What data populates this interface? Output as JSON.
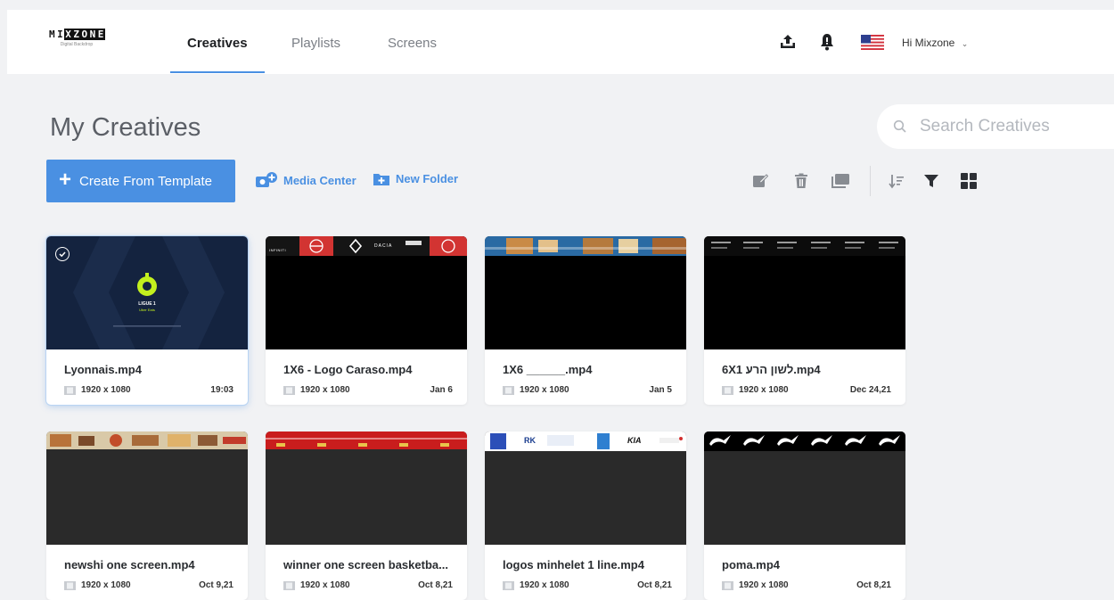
{
  "app": {
    "logo_word": [
      "M",
      "I",
      "X",
      "Z",
      "O",
      "N",
      "E"
    ],
    "logo_sub": "Digital Backdrop"
  },
  "nav": {
    "tabs": [
      {
        "label": "Creatives",
        "active": true
      },
      {
        "label": "Playlists",
        "active": false
      },
      {
        "label": "Screens",
        "active": false
      }
    ],
    "user_greeting": "Hi Mixzone",
    "icons": [
      "upload-icon",
      "bell-icon",
      "us-flag-icon",
      "chevron-down-icon"
    ]
  },
  "page": {
    "title": "My Creatives",
    "search_placeholder": "Search Creatives",
    "create_label": "Create From Template",
    "media_center_label": "Media Center",
    "new_folder_label": "New Folder",
    "toolbar_icons": [
      "edit-icon",
      "trash-icon",
      "duplicate-icon",
      "sort-icon",
      "filter-icon",
      "grid-view-icon"
    ]
  },
  "colors": {
    "accent": "#4a90e2",
    "background": "#f1f2f4",
    "card": "#ffffff"
  },
  "creatives": [
    {
      "name": "Lyonnais.mp4",
      "resolution": "1920 x 1080",
      "date": "19:03",
      "selected": true,
      "thumb": "ligue1",
      "thumb_text": [
        "LIGUE 1",
        "Uber Eats"
      ]
    },
    {
      "name": "1X6 - Logo Caraso.mp4",
      "resolution": "1920 x 1080",
      "date": "Jan 6",
      "selected": false,
      "thumb": "logos-red",
      "thumb_text": [
        "INFINITI",
        "DACIA"
      ]
    },
    {
      "name": "1X6 ______.mp4",
      "resolution": "1920 x 1080",
      "date": "Jan 5",
      "selected": false,
      "thumb": "food-banner",
      "thumb_text": []
    },
    {
      "name": "6X1 לשון הרע.mp4",
      "resolution": "1920 x 1080",
      "date": "Dec 24,21",
      "selected": false,
      "thumb": "dark-text",
      "thumb_text": []
    },
    {
      "name": "newshi one screen.mp4",
      "resolution": "1920 x 1080",
      "date": "Oct 9,21",
      "selected": false,
      "thumb": "food-strip",
      "thumb_text": []
    },
    {
      "name": "winner one screen basketba...",
      "resolution": "1920 x 1080",
      "date": "Oct 8,21",
      "selected": false,
      "thumb": "red-strip",
      "thumb_text": []
    },
    {
      "name": "logos minhelet 1 line.mp4",
      "resolution": "1920 x 1080",
      "date": "Oct 8,21",
      "selected": false,
      "thumb": "logo-strip",
      "thumb_text": [
        "RK",
        "KIA"
      ]
    },
    {
      "name": "poma.mp4",
      "resolution": "1920 x 1080",
      "date": "Oct 8,21",
      "selected": false,
      "thumb": "puma-strip",
      "thumb_text": []
    }
  ]
}
